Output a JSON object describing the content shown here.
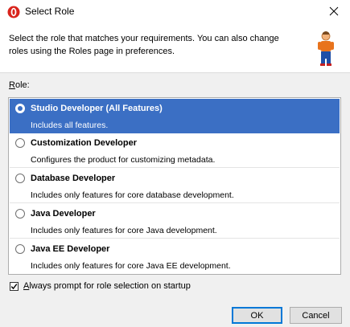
{
  "window": {
    "title": "Select Role",
    "app_icon": "oracle-o-icon",
    "close_icon": "close-icon"
  },
  "header": {
    "instruction": "Select the role that matches your requirements. You can also change roles using the Roles page in preferences.",
    "icon": "person-icon"
  },
  "role_label": {
    "mnemonic": "R",
    "rest": "ole:"
  },
  "roles": [
    {
      "name": "Studio Developer (All Features)",
      "description": "Includes all features.",
      "selected": true
    },
    {
      "name": "Customization Developer",
      "description": "Configures the product for customizing metadata.",
      "selected": false
    },
    {
      "name": "Database Developer",
      "description": "Includes only features for core database development.",
      "selected": false
    },
    {
      "name": "Java Developer",
      "description": "Includes only features for core Java development.",
      "selected": false
    },
    {
      "name": "Java EE Developer",
      "description": "Includes only features for core Java EE development.",
      "selected": false
    }
  ],
  "always_prompt": {
    "mnemonic": "A",
    "rest": "lways prompt for role selection on startup",
    "checked": true
  },
  "buttons": {
    "ok": "OK",
    "cancel": "Cancel"
  },
  "colors": {
    "selection": "#3b6fc4",
    "ok_border": "#0078d7"
  }
}
